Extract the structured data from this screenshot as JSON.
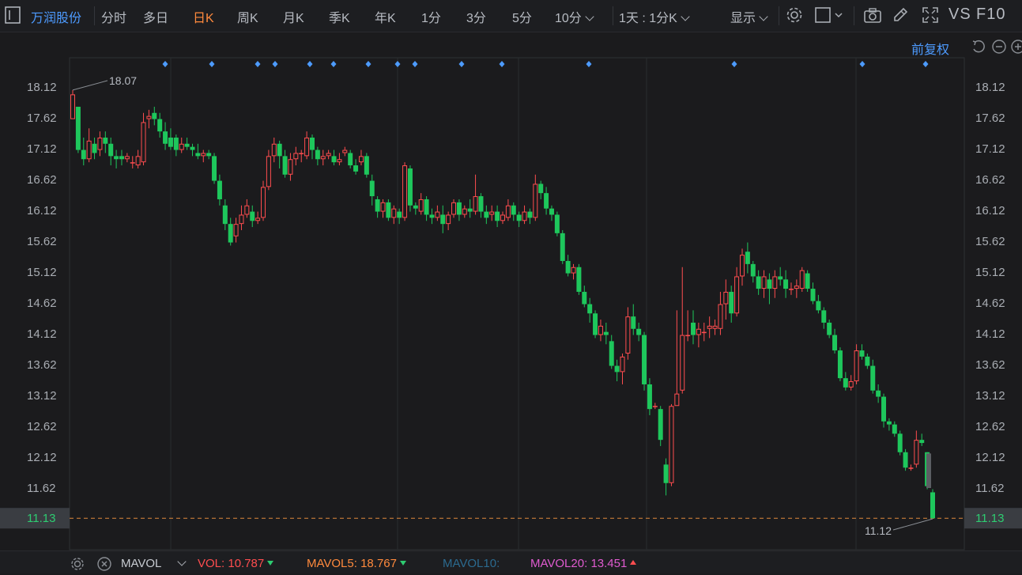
{
  "toolbar": {
    "stock_name": "万润股份",
    "tabs": [
      "分时",
      "多日",
      "日K",
      "周K",
      "月K",
      "季K",
      "年K",
      "1分",
      "3分",
      "5分",
      "10分"
    ],
    "active_tab": "日K",
    "period_selector": "1天 : 1分K",
    "display_label": "显示",
    "vs_label": "VS",
    "f10_label": "F10"
  },
  "chart": {
    "adjust_label": "前复权",
    "y_ticks": [
      "18.12",
      "17.62",
      "17.12",
      "16.62",
      "16.12",
      "15.62",
      "15.12",
      "14.62",
      "14.12",
      "13.62",
      "13.12",
      "12.62",
      "12.12",
      "11.62"
    ],
    "current_price": "11.13",
    "high_annotation": "18.07",
    "low_annotation": "11.12",
    "colors": {
      "up": "#ff4d4f",
      "down": "#1ec75c",
      "current": "#2ecc71",
      "event_marker": "#4d9bff"
    }
  },
  "chart_data": {
    "type": "candlestick",
    "y_range": [
      11.0,
      18.4
    ],
    "candles": [
      [
        17.6,
        18.0,
        18.07,
        17.6
      ],
      [
        17.8,
        17.1,
        17.8,
        17.05
      ],
      [
        17.1,
        16.95,
        17.3,
        16.85
      ],
      [
        16.95,
        17.25,
        17.45,
        16.9
      ],
      [
        17.2,
        17.05,
        17.3,
        16.95
      ],
      [
        17.1,
        17.3,
        17.4,
        17.0
      ],
      [
        17.3,
        17.2,
        17.4,
        17.05
      ],
      [
        17.2,
        17.0,
        17.3,
        16.85
      ],
      [
        17.0,
        16.95,
        17.1,
        16.8
      ],
      [
        17.0,
        16.95,
        17.1,
        16.85
      ],
      [
        16.95,
        17.0,
        17.05,
        16.9
      ],
      [
        16.9,
        16.9,
        17.0,
        16.8
      ],
      [
        16.85,
        17.0,
        17.1,
        16.8
      ],
      [
        16.9,
        17.55,
        17.7,
        16.85
      ],
      [
        17.6,
        17.65,
        17.75,
        17.45
      ],
      [
        17.7,
        17.6,
        17.8,
        17.5
      ],
      [
        17.6,
        17.4,
        17.7,
        17.3
      ],
      [
        17.4,
        17.2,
        17.55,
        17.1
      ],
      [
        17.3,
        17.15,
        17.45,
        17.1
      ],
      [
        17.3,
        17.1,
        17.35,
        17.0
      ],
      [
        17.1,
        17.2,
        17.3,
        17.05
      ],
      [
        17.2,
        17.15,
        17.3,
        17.1
      ],
      [
        17.15,
        17.1,
        17.2,
        17.0
      ],
      [
        17.05,
        17.0,
        17.2,
        16.95
      ],
      [
        17.0,
        17.05,
        17.1,
        16.9
      ],
      [
        17.05,
        17.0,
        17.1,
        16.95
      ],
      [
        17.0,
        16.6,
        17.05,
        16.55
      ],
      [
        16.6,
        16.3,
        16.7,
        16.2
      ],
      [
        16.2,
        15.9,
        16.3,
        15.8
      ],
      [
        15.9,
        15.6,
        16.0,
        15.55
      ],
      [
        15.7,
        15.9,
        16.0,
        15.6
      ],
      [
        15.9,
        16.05,
        16.2,
        15.8
      ],
      [
        16.05,
        16.2,
        16.3,
        16.0
      ],
      [
        16.1,
        15.95,
        16.2,
        15.85
      ],
      [
        15.95,
        16.0,
        16.1,
        15.9
      ],
      [
        16.0,
        16.5,
        16.6,
        15.95
      ],
      [
        16.5,
        17.0,
        17.1,
        16.45
      ],
      [
        17.0,
        17.2,
        17.3,
        16.9
      ],
      [
        17.2,
        17.0,
        17.25,
        16.8
      ],
      [
        17.0,
        16.7,
        17.1,
        16.65
      ],
      [
        16.7,
        16.95,
        17.05,
        16.6
      ],
      [
        16.95,
        17.05,
        17.15,
        16.85
      ],
      [
        17.05,
        17.05,
        17.1,
        16.9
      ],
      [
        17.0,
        17.3,
        17.4,
        16.95
      ],
      [
        17.3,
        17.1,
        17.35,
        16.95
      ],
      [
        17.1,
        16.95,
        17.15,
        16.85
      ],
      [
        16.95,
        17.0,
        17.1,
        16.85
      ],
      [
        17.0,
        17.05,
        17.1,
        16.95
      ],
      [
        17.0,
        16.9,
        17.1,
        16.85
      ],
      [
        16.9,
        16.95,
        17.05,
        16.85
      ],
      [
        17.05,
        17.1,
        17.15,
        17.0
      ],
      [
        17.05,
        16.85,
        17.1,
        16.8
      ],
      [
        16.85,
        16.75,
        16.95,
        16.7
      ],
      [
        16.9,
        17.0,
        17.1,
        16.85
      ],
      [
        17.0,
        16.7,
        17.05,
        16.65
      ],
      [
        16.6,
        16.35,
        16.7,
        16.2
      ],
      [
        16.3,
        16.1,
        16.35,
        16.0
      ],
      [
        16.1,
        16.25,
        16.3,
        16.0
      ],
      [
        16.25,
        16.0,
        16.3,
        15.95
      ],
      [
        16.0,
        16.15,
        16.2,
        15.9
      ],
      [
        16.1,
        16.0,
        16.15,
        15.9
      ],
      [
        16.0,
        16.85,
        16.9,
        15.95
      ],
      [
        16.8,
        16.2,
        16.85,
        16.1
      ],
      [
        16.2,
        16.15,
        16.25,
        16.05
      ],
      [
        16.1,
        16.3,
        16.4,
        16.05
      ],
      [
        16.3,
        16.05,
        16.35,
        15.95
      ],
      [
        16.05,
        16.0,
        16.15,
        15.9
      ],
      [
        16.0,
        16.1,
        16.2,
        15.95
      ],
      [
        16.05,
        15.9,
        16.2,
        15.75
      ],
      [
        15.9,
        16.05,
        16.1,
        15.8
      ],
      [
        16.05,
        16.25,
        16.3,
        16.0
      ],
      [
        16.25,
        16.05,
        16.3,
        15.95
      ],
      [
        16.05,
        16.15,
        16.2,
        16.0
      ],
      [
        16.15,
        16.1,
        16.3,
        16.0
      ],
      [
        16.1,
        16.35,
        16.7,
        16.05
      ],
      [
        16.35,
        16.1,
        16.4,
        16.0
      ],
      [
        16.1,
        16.0,
        16.2,
        15.9
      ],
      [
        16.05,
        16.1,
        16.2,
        15.95
      ],
      [
        16.1,
        15.95,
        16.2,
        15.85
      ],
      [
        15.95,
        16.05,
        16.1,
        15.9
      ],
      [
        16.0,
        16.2,
        16.3,
        15.95
      ],
      [
        16.2,
        16.05,
        16.25,
        15.95
      ],
      [
        16.05,
        15.95,
        16.1,
        15.85
      ],
      [
        15.95,
        16.1,
        16.2,
        15.9
      ],
      [
        16.1,
        16.0,
        16.15,
        15.9
      ],
      [
        16.0,
        16.55,
        16.7,
        15.95
      ],
      [
        16.55,
        16.4,
        16.6,
        16.3
      ],
      [
        16.4,
        16.15,
        16.5,
        16.05
      ],
      [
        16.15,
        16.05,
        16.2,
        15.95
      ],
      [
        16.05,
        15.75,
        16.1,
        15.7
      ],
      [
        15.75,
        15.3,
        15.8,
        15.25
      ],
      [
        15.3,
        15.1,
        15.4,
        15.05
      ],
      [
        15.1,
        15.2,
        15.25,
        15.0
      ],
      [
        15.2,
        14.8,
        15.25,
        14.75
      ],
      [
        14.8,
        14.6,
        14.9,
        14.55
      ],
      [
        14.6,
        14.45,
        14.7,
        14.3
      ],
      [
        14.45,
        14.1,
        14.5,
        14.05
      ],
      [
        14.1,
        14.25,
        14.35,
        14.0
      ],
      [
        14.15,
        14.1,
        14.3,
        13.95
      ],
      [
        14.0,
        13.6,
        14.1,
        13.55
      ],
      [
        13.6,
        13.5,
        13.7,
        13.35
      ],
      [
        13.5,
        13.75,
        13.8,
        13.3
      ],
      [
        13.8,
        14.4,
        14.55,
        13.7
      ],
      [
        14.4,
        14.2,
        14.6,
        14.1
      ],
      [
        14.2,
        14.1,
        14.3,
        14.0
      ],
      [
        14.1,
        13.3,
        14.15,
        13.2
      ],
      [
        13.3,
        12.9,
        13.4,
        12.8
      ],
      [
        12.95,
        12.95,
        13.0,
        12.9
      ],
      [
        12.9,
        12.4,
        12.95,
        12.3
      ],
      [
        12.0,
        11.7,
        12.1,
        11.5
      ],
      [
        11.7,
        12.95,
        12.98,
        11.65
      ],
      [
        12.95,
        13.15,
        14.5,
        13.0
      ],
      [
        13.2,
        14.1,
        15.2,
        13.15
      ],
      [
        14.1,
        14.1,
        14.5,
        14.0
      ],
      [
        14.3,
        14.1,
        14.5,
        13.95
      ],
      [
        14.1,
        14.2,
        14.3,
        13.9
      ],
      [
        14.15,
        14.15,
        14.3,
        14.0
      ],
      [
        14.2,
        14.25,
        14.4,
        14.05
      ],
      [
        14.2,
        14.25,
        14.35,
        14.1
      ],
      [
        14.2,
        14.6,
        14.8,
        14.1
      ],
      [
        14.6,
        14.8,
        15.0,
        14.35
      ],
      [
        14.8,
        14.45,
        14.9,
        14.3
      ],
      [
        14.45,
        15.05,
        15.2,
        14.4
      ],
      [
        15.05,
        15.4,
        15.5,
        14.9
      ],
      [
        15.45,
        15.25,
        15.6,
        15.1
      ],
      [
        15.25,
        15.05,
        15.3,
        14.95
      ],
      [
        15.05,
        14.85,
        15.15,
        14.75
      ],
      [
        14.85,
        15.05,
        15.15,
        14.7
      ],
      [
        15.0,
        14.85,
        15.1,
        14.6
      ],
      [
        14.85,
        15.05,
        15.15,
        14.7
      ],
      [
        15.05,
        15.0,
        15.2,
        14.9
      ],
      [
        15.0,
        14.85,
        15.15,
        14.7
      ],
      [
        14.85,
        14.85,
        14.95,
        14.75
      ],
      [
        14.85,
        14.9,
        15.0,
        14.7
      ],
      [
        14.85,
        15.15,
        15.2,
        14.8
      ],
      [
        15.1,
        14.85,
        15.15,
        14.8
      ],
      [
        14.85,
        14.65,
        14.95,
        14.6
      ],
      [
        14.65,
        14.5,
        14.75,
        14.45
      ],
      [
        14.5,
        14.3,
        14.55,
        14.2
      ],
      [
        14.3,
        14.1,
        14.35,
        14.05
      ],
      [
        14.1,
        13.85,
        14.2,
        13.8
      ],
      [
        13.85,
        13.4,
        13.9,
        13.35
      ],
      [
        13.4,
        13.25,
        13.5,
        13.2
      ],
      [
        13.25,
        13.35,
        13.45,
        13.2
      ],
      [
        13.35,
        13.85,
        13.95,
        13.3
      ],
      [
        13.85,
        13.75,
        13.95,
        13.7
      ],
      [
        13.75,
        13.6,
        13.8,
        13.55
      ],
      [
        13.6,
        13.2,
        13.7,
        13.15
      ],
      [
        13.2,
        13.1,
        13.3,
        13.0
      ],
      [
        13.1,
        12.7,
        13.15,
        12.6
      ],
      [
        12.7,
        12.65,
        12.75,
        12.55
      ],
      [
        12.65,
        12.5,
        12.7,
        12.45
      ],
      [
        12.5,
        12.2,
        12.55,
        12.15
      ],
      [
        12.2,
        11.95,
        12.25,
        11.9
      ],
      [
        11.95,
        11.95,
        12.0,
        11.9
      ],
      [
        12.0,
        12.4,
        12.55,
        11.95
      ],
      [
        12.4,
        12.35,
        12.5,
        12.3
      ],
      [
        12.2,
        11.65,
        12.2,
        11.6
      ],
      [
        11.55,
        11.13,
        11.6,
        11.12
      ]
    ]
  },
  "bottom_bar": {
    "indicator": "MAVOL",
    "vol_label": "VOL:",
    "vol_value": "10.787",
    "mavol5_label": "MAVOL5:",
    "mavol5_value": "18.767",
    "mavol10_label": "MAVOL10:",
    "mavol20_label": "MAVOL20:",
    "mavol20_value": "13.451",
    "colors": {
      "vol": "#ff4d4f",
      "mavol5": "#ff8a3d",
      "mavol10": "#2b6a8f",
      "mavol20": "#e05bd0"
    }
  }
}
